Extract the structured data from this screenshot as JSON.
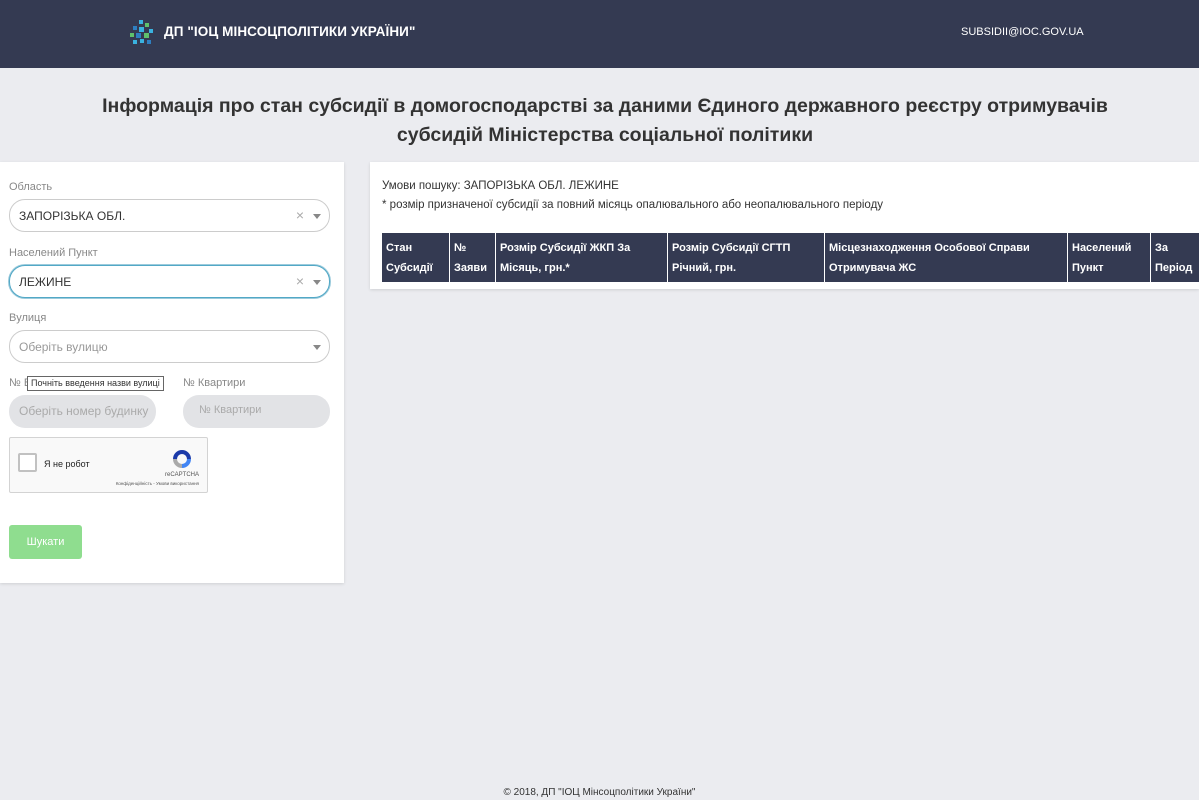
{
  "header": {
    "brand": "ДП \"ІОЦ МІНСОЦПОЛІТИКИ УКРАЇНИ\"",
    "email": "SUBSIDII@IOC.GOV.UA",
    "colors": {
      "bar": "#343a52",
      "logo": [
        "#3ab2e0",
        "#5fc16c",
        "#2e7fc1"
      ]
    }
  },
  "page_title": "Інформація про стан субсидії в домогосподарстві за даними Єдиного державного реєстру отримувачів субсидій Міністерства соціальної політики",
  "form": {
    "region": {
      "label": "Область",
      "value": "ЗАПОРІЗЬКА ОБЛ.",
      "clear": "×"
    },
    "locality": {
      "label": "Населений Пункт",
      "value": "ЛЕЖИНЕ",
      "clear": "×"
    },
    "street": {
      "label": "Вулиця",
      "placeholder": "Оберіть вулицю"
    },
    "house": {
      "label": "№ Б",
      "placeholder": "Оберіть номер будинку"
    },
    "apartment": {
      "label": "№ Квартири",
      "placeholder": "№ Квартири"
    },
    "tooltip": "Почніть введення назви вулиці",
    "recaptcha": {
      "label": "Я не робот",
      "brand": "reCAPTCHA",
      "privacy": "Конфіденційність - Умови використання"
    },
    "search_button": "Шукати",
    "search_button_color": "#8fdd8f"
  },
  "results": {
    "conditions": "Умови пошуку: ЗАПОРІЗЬКА ОБЛ. ЛЕЖИНЕ",
    "note": "* розмір призначеної субсидії за повний місяць опалювального або неопалювального періоду",
    "columns": [
      "Стан Субсидії",
      "№ Заяви",
      "Розмір Субсидії ЖКП За Місяць, грн.*",
      "Розмір Субсидії СГТП Річний, грн.",
      "Місцезнаходження Особової Справи Отримувача ЖС",
      "Населений Пункт",
      "За Період"
    ]
  },
  "footer": "© 2018, ДП \"ІОЦ Мінсоцполітики України\""
}
